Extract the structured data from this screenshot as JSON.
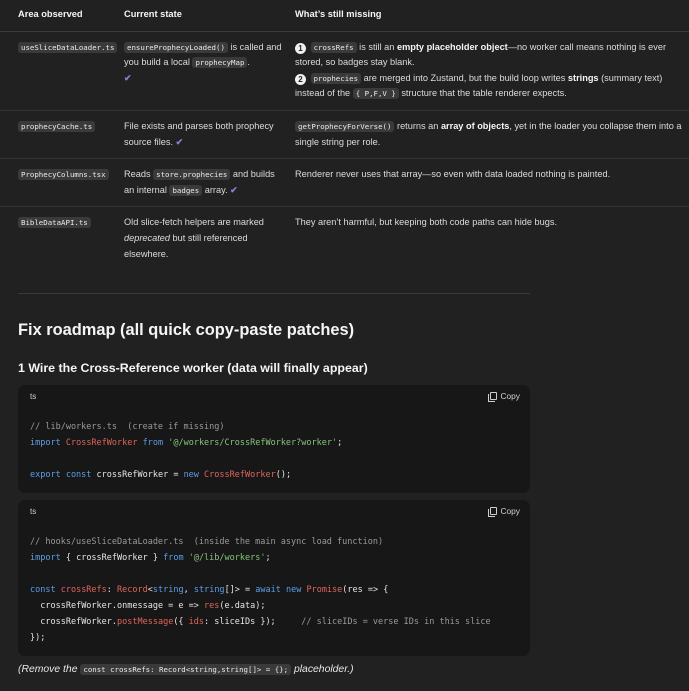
{
  "table": {
    "headers": [
      "Area observed",
      "Current state",
      "What’s still missing"
    ],
    "rows": [
      {
        "area": "useSliceDataLoader.ts",
        "state": {
          "code1": "ensureProphecyLoaded()",
          "t1": " is called and you build a local ",
          "code2": "prophecyMap",
          "t2": ".",
          "check": "✔"
        },
        "missing": {
          "n1": "1",
          "code1": "crossRefs",
          "t1": " is still an ",
          "b1": "empty placeholder object",
          "t2": "—no worker call means nothing is ever stored, so badges stay blank.",
          "n2": "2",
          "code2": "prophecies",
          "t3": " are merged into Zustand, but the build loop writes ",
          "b2": "strings",
          "t4": " (summary text) instead of the ",
          "code3": "{ P,F,V }",
          "t5": " structure that the table renderer expects."
        }
      },
      {
        "area": "prophecyCache.ts",
        "state": {
          "t1": "File exists and parses both prophecy source files. ",
          "check": "✔"
        },
        "missing": {
          "code1": "getProphecyForVerse()",
          "t1": " returns an ",
          "b1": "array of objects",
          "t2": ", yet in the loader you collapse them into a single string per role."
        }
      },
      {
        "area": "ProphecyColumns.tsx",
        "state": {
          "t1": "Reads ",
          "code1": "store.prophecies",
          "t2": " and builds an internal ",
          "code2": "badges",
          "t3": " array. ",
          "check": "✔"
        },
        "missing": {
          "t1": "Renderer never uses that array—so even with data loaded nothing is painted."
        }
      },
      {
        "area": "BibleDataAPI.ts",
        "state": {
          "t1": "Old slice-fetch helpers are marked ",
          "i1": "deprecated",
          "t2": " but still referenced elsewhere."
        },
        "missing": {
          "t1": "They aren’t harmful, but keeping both code paths can hide bugs."
        }
      }
    ]
  },
  "roadmap": {
    "title": "Fix roadmap (all quick copy-paste patches)",
    "step1": "1  Wire the Cross-Reference worker (data will finally appear)"
  },
  "code_blocks": [
    {
      "lang": "ts",
      "copy_label": "Copy",
      "lines": {
        "l1": "// lib/workers.ts  (create if missing)",
        "l2_kw": "import",
        "l2_ty": "CrossRefWorker",
        "l2_kw2": "from",
        "l2_st": "'@/workers/CrossRefWorker?worker'",
        "l2_end": ";",
        "l3_kw": "export const",
        "l3_id": "crossRefWorker",
        "l3_eq": " = ",
        "l3_kw2": "new",
        "l3_ty": "CrossRefWorker",
        "l3_end": "();"
      }
    },
    {
      "lang": "ts",
      "copy_label": "Copy",
      "lines": {
        "l1": "// hooks/useSliceDataLoader.ts  (inside the main async load function)",
        "l2_kw": "import",
        "l2_mid": "{ crossRefWorker }",
        "l2_kw2": "from",
        "l2_st": "'@/lib/workers'",
        "l2_end": ";",
        "l3_kw": "const",
        "l3_id": "crossRefs",
        "l3_colon": ": ",
        "l3_ty": "Record",
        "l3_lt": "<",
        "l3_kw3": "string",
        "l3_comma": ", ",
        "l3_kw4": "string",
        "l3_arr": "[]> = ",
        "l3_kw5": "await new",
        "l3_ty2": "Promise",
        "l3_end": "(res => {",
        "l4_a": "crossRefWorker.onmessage = e => ",
        "l4_fn": "res",
        "l4_b": "(e.data);",
        "l5_a": "crossRefWorker.",
        "l5_fn": "postMessage",
        "l5_b": "({ ",
        "l5_key": "ids",
        "l5_c": ": sliceIDs });",
        "l5_cm": "// sliceIDs = verse IDs in this slice",
        "l6": "});"
      }
    }
  ],
  "note": {
    "t1": "(Remove the ",
    "code": "const crossRefs: Record<string,string[]> = {};",
    "t2": " placeholder.)"
  }
}
